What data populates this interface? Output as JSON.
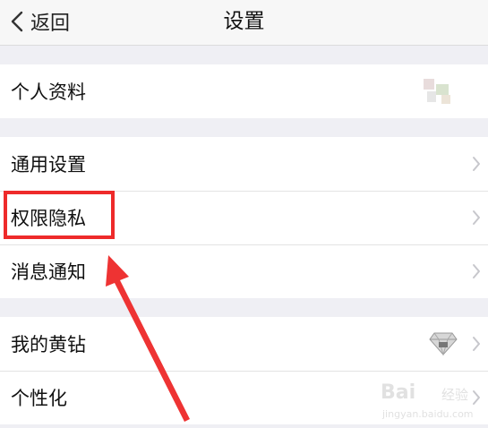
{
  "nav": {
    "back_label": "返回",
    "title": "设置"
  },
  "groups": [
    {
      "items": [
        {
          "label": "个人资料"
        }
      ]
    },
    {
      "items": [
        {
          "label": "通用设置"
        },
        {
          "label": "权限隐私"
        },
        {
          "label": "消息通知"
        }
      ]
    },
    {
      "items": [
        {
          "label": "我的黄钻"
        },
        {
          "label": "个性化"
        }
      ]
    }
  ],
  "watermark": {
    "brand": "Bai",
    "brand_suffix": "经验",
    "url": "jingyan.baidu.com"
  },
  "colors": {
    "highlight": "#ee2a2a",
    "background": "#efeff4",
    "chevron": "#c7c7cc"
  },
  "icons": {
    "back": "chevron-left-icon",
    "row_arrow": "chevron-right-icon",
    "yellow_diamond": "diamond-icon"
  }
}
